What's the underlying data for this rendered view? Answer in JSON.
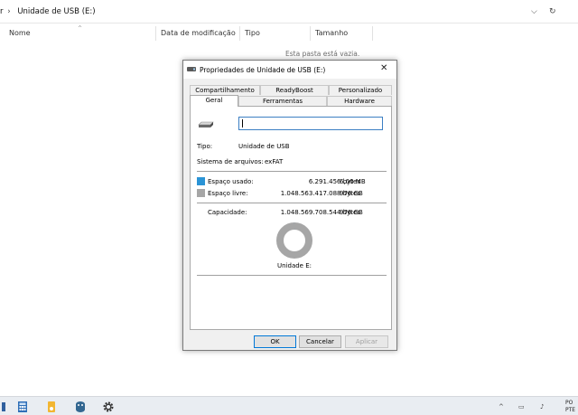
{
  "explorer": {
    "path_prefix": "r",
    "path_separator": "›",
    "path_current": "Unidade de USB (E:)",
    "dropdown_glyph": "⌵",
    "refresh_glyph": "↻",
    "columns": [
      "Nome",
      "Data de modificação",
      "Tipo",
      "Tamanho"
    ],
    "sort_glyph": "^",
    "empty_message": "Esta pasta está vazia."
  },
  "dialog": {
    "title": "Propriedades de Unidade de USB (E:)",
    "close_glyph": "✕",
    "tabs_back": [
      "Compartilhamento",
      "ReadyBoost",
      "Personalizado"
    ],
    "tabs_front": [
      "Geral",
      "Ferramentas",
      "Hardware"
    ],
    "active_tab": "Geral",
    "name_value": "",
    "type_label": "Tipo:",
    "type_value": "Unidade de USB",
    "fs_label": "Sistema de arquivos:",
    "fs_value": "exFAT",
    "used_label": "Espaço usado:",
    "used_bytes": "6.291.456 bytes",
    "used_human": "6,00 MB",
    "free_label": "Espaço livre:",
    "free_bytes": "1.048.563.417.088 bytes",
    "free_human": "976 GB",
    "capacity_label": "Capacidade:",
    "capacity_bytes": "1.048.569.708.544 bytes",
    "capacity_human": "976 GB",
    "drive_label": "Unidade E:",
    "buttons": {
      "ok": "OK",
      "cancel": "Cancelar",
      "apply": "Aplicar"
    },
    "used_fraction": 6e-06,
    "colors": {
      "used": "#2b94d6",
      "free": "#a6a6a6"
    }
  },
  "taskbar": {
    "lang": [
      "PO",
      "PTE"
    ],
    "tray": [
      "^",
      "▭",
      "♪"
    ]
  }
}
